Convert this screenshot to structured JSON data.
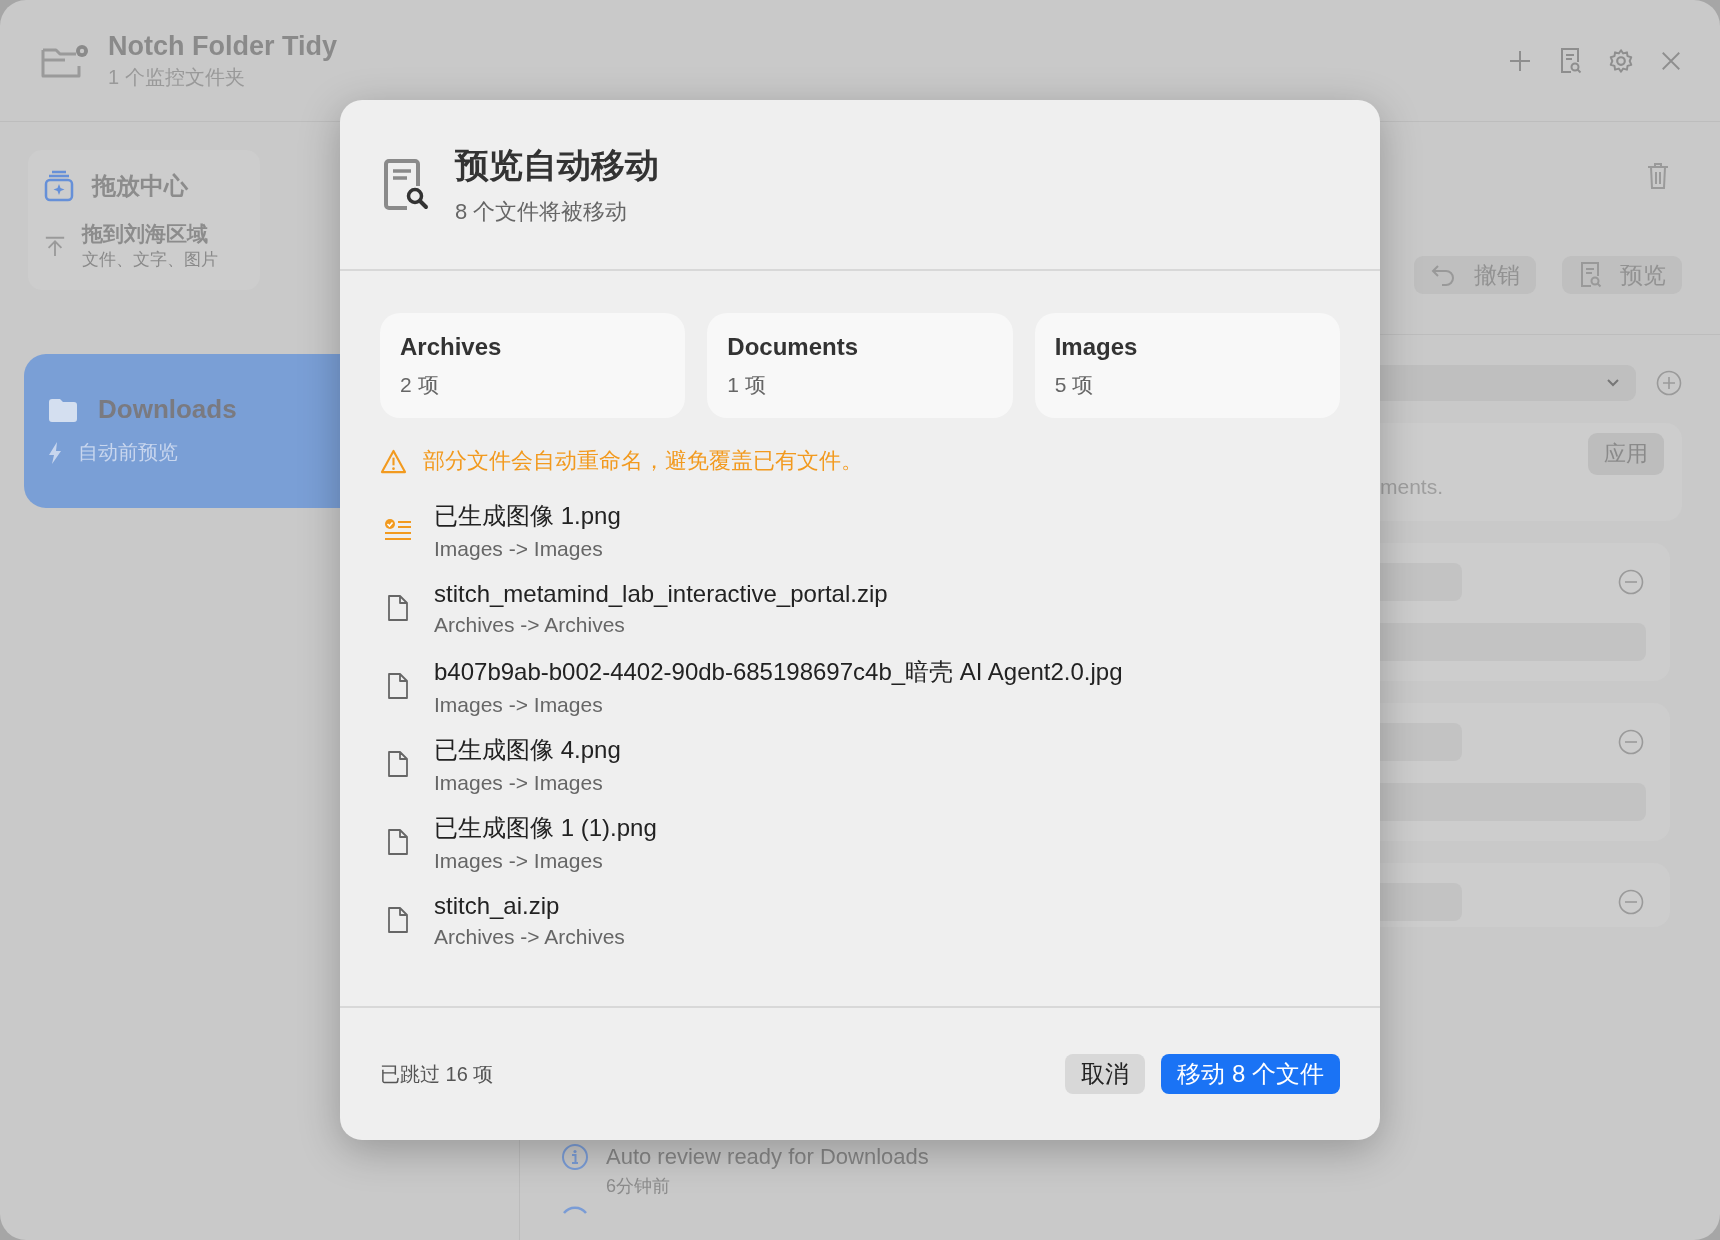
{
  "window": {
    "title": "Notch Folder Tidy",
    "subtitle": "1 个监控文件夹"
  },
  "sidebar": {
    "drop_center": {
      "title": "拖放中心",
      "target": "拖到刘海区域",
      "hint": "文件、文字、图片"
    },
    "folders": [
      {
        "name": "Downloads",
        "mode": "自动前预览",
        "selected": true
      }
    ]
  },
  "toolbar": {
    "buttons": [
      {
        "kind": "undo",
        "label": "撤销"
      },
      {
        "kind": "preview",
        "label": "预览"
      }
    ]
  },
  "rule_card": {
    "text": "ments.",
    "button": "应用"
  },
  "activity": [
    {
      "message": "Auto review ready for Downloads",
      "time": "6分钟前"
    }
  ],
  "dialog": {
    "title": "预览自动移动",
    "subtitle": "8 个文件将被移动",
    "summary": [
      {
        "name": "Archives",
        "count": "2 项"
      },
      {
        "name": "Documents",
        "count": "1 项"
      },
      {
        "name": "Images",
        "count": "5 项"
      }
    ],
    "warning": "部分文件会自动重命名，避免覆盖已有文件。",
    "files": [
      {
        "kind": "renamed",
        "name": "已生成图像 1.png",
        "route": "Images -> Images"
      },
      {
        "kind": "file",
        "name": "stitch_metamind_lab_interactive_portal.zip",
        "route": "Archives -> Archives"
      },
      {
        "kind": "file",
        "name": "b407b9ab-b002-4402-90db-685198697c4b_暗壳 AI Agent2.0.jpg",
        "route": "Images -> Images"
      },
      {
        "kind": "file",
        "name": "已生成图像 4.png",
        "route": "Images -> Images"
      },
      {
        "kind": "file",
        "name": "已生成图像 1 (1).png",
        "route": "Images -> Images"
      },
      {
        "kind": "file",
        "name": "stitch_ai.zip",
        "route": "Archives -> Archives"
      }
    ],
    "skipped": "已跳过 16 项",
    "cancel": "取消",
    "confirm": "移动 8 个文件"
  }
}
